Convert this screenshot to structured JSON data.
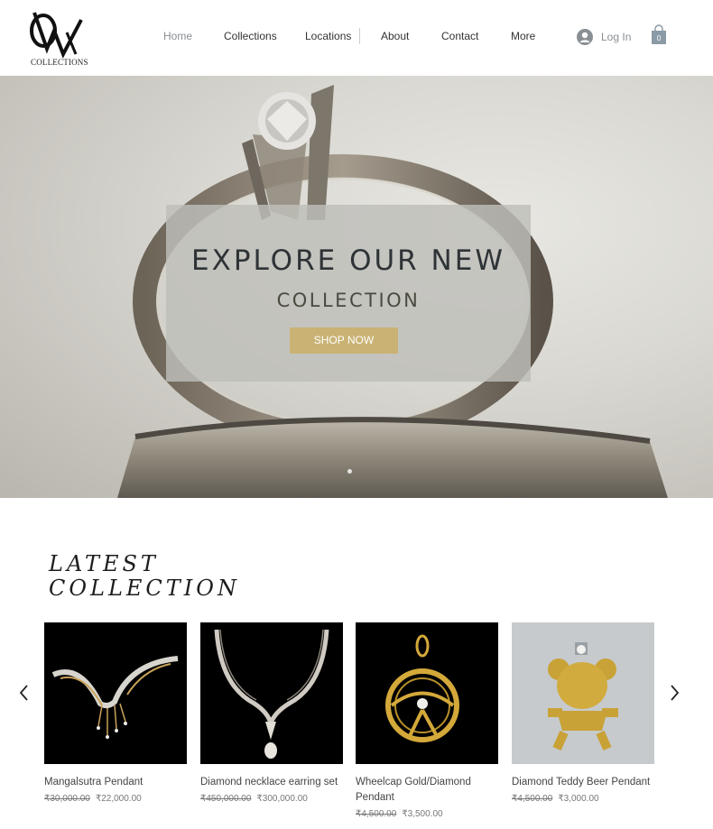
{
  "header": {
    "logo_text": "COLLECTIONS",
    "nav": [
      "Home",
      "Collections",
      "Locations",
      "About",
      "Contact",
      "More"
    ],
    "login_label": "Log In",
    "cart_count": "0"
  },
  "hero": {
    "title": "EXPLORE OUR NEW",
    "subtitle": "COLLECTION",
    "button": "SHOP NOW"
  },
  "latest": {
    "title_line1": "LATEST",
    "title_line2": "COLLECTION",
    "products": [
      {
        "name": "Mangalsutra Pendant",
        "old_price": "₹30,000.00",
        "price": "₹22,000.00"
      },
      {
        "name": "Diamond necklace earring set",
        "old_price": "₹450,000.00",
        "price": "₹300,000.00"
      },
      {
        "name": "Wheelcap Gold/Diamond Pendant",
        "old_price": "₹4,500.00",
        "price": "₹3,500.00"
      },
      {
        "name": "Diamond Teddy Beer Pendant",
        "old_price": "₹4,500.00",
        "price": "₹3,000.00"
      }
    ]
  },
  "colors": {
    "accent": "#c9b273",
    "text": "#333333",
    "muted": "#8a8f93"
  }
}
